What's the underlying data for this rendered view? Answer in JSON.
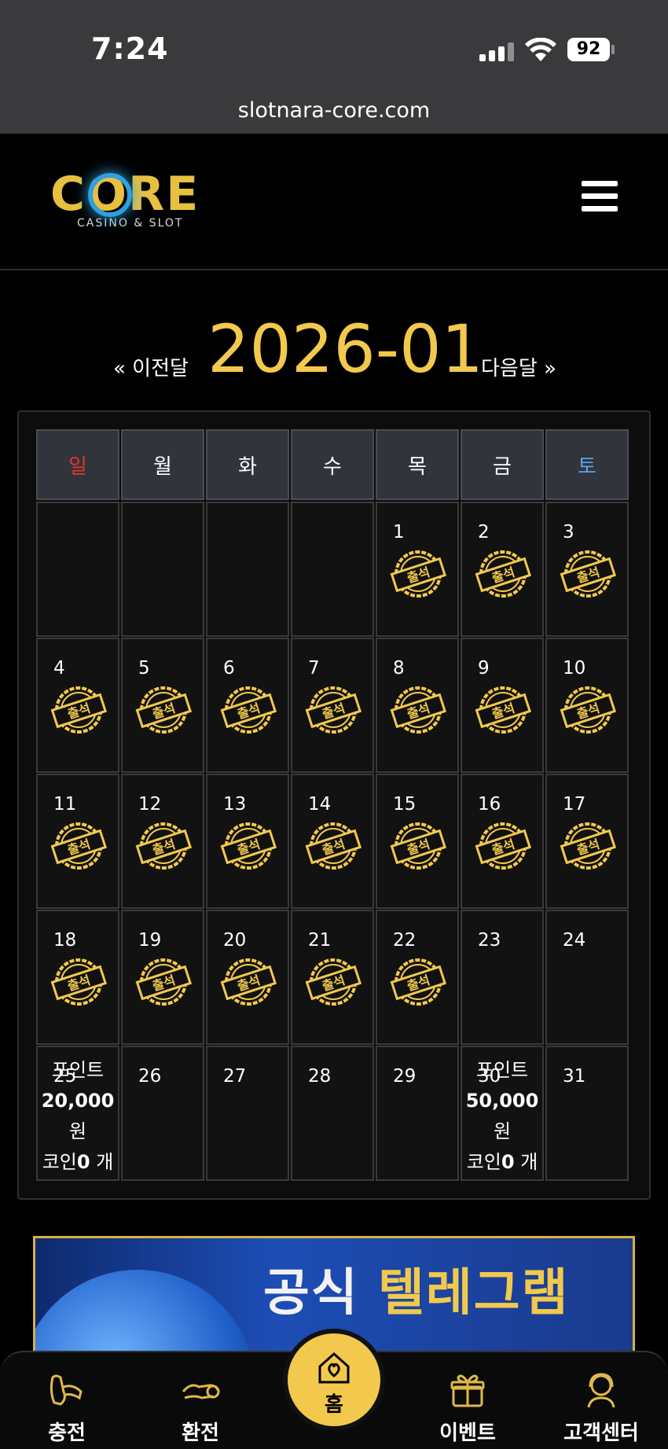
{
  "status_bar": {
    "time": "7:24",
    "battery": "92"
  },
  "browser": {
    "url": "slotnara-core.com"
  },
  "header": {
    "logo_text": "CORE",
    "logo_subtitle": "CASINO & SLOT"
  },
  "calendar": {
    "prev_label": "« 이전달",
    "next_label": "다음달 »",
    "month": "2026-01",
    "weekdays": [
      "일",
      "월",
      "화",
      "수",
      "목",
      "금",
      "토"
    ],
    "stamp_label": "출석",
    "weeks": [
      [
        null,
        null,
        null,
        null,
        {
          "day": "1",
          "stamp": true
        },
        {
          "day": "2",
          "stamp": true
        },
        {
          "day": "3",
          "stamp": true
        }
      ],
      [
        {
          "day": "4",
          "stamp": true
        },
        {
          "day": "5",
          "stamp": true
        },
        {
          "day": "6",
          "stamp": true
        },
        {
          "day": "7",
          "stamp": true
        },
        {
          "day": "8",
          "stamp": true
        },
        {
          "day": "9",
          "stamp": true
        },
        {
          "day": "10",
          "stamp": true
        }
      ],
      [
        {
          "day": "11",
          "stamp": true
        },
        {
          "day": "12",
          "stamp": true
        },
        {
          "day": "13",
          "stamp": true
        },
        {
          "day": "14",
          "stamp": true
        },
        {
          "day": "15",
          "stamp": true
        },
        {
          "day": "16",
          "stamp": true
        },
        {
          "day": "17",
          "stamp": true
        }
      ],
      [
        {
          "day": "18",
          "stamp": true
        },
        {
          "day": "19",
          "stamp": true
        },
        {
          "day": "20",
          "stamp": true
        },
        {
          "day": "21",
          "stamp": true
        },
        {
          "day": "22",
          "stamp": true
        },
        {
          "day": "23",
          "stamp": false
        },
        {
          "day": "24",
          "stamp": false
        }
      ],
      [
        {
          "day": "25",
          "stamp": false,
          "reward": {
            "point_label": "포인트",
            "amount": "20,000",
            "unit": "원",
            "coin_label": "코인",
            "coin_count": "0",
            "coin_unit": " 개"
          }
        },
        {
          "day": "26",
          "stamp": false
        },
        {
          "day": "27",
          "stamp": false
        },
        {
          "day": "28",
          "stamp": false
        },
        {
          "day": "29",
          "stamp": false
        },
        {
          "day": "30",
          "stamp": false,
          "reward": {
            "point_label": "포인트",
            "amount": "50,000",
            "unit": "원",
            "coin_label": "코인",
            "coin_count": "0",
            "coin_unit": " 개"
          }
        },
        {
          "day": "31",
          "stamp": false
        }
      ]
    ]
  },
  "banner": {
    "text_white": "공식",
    "text_gold": "텔레그램"
  },
  "bottom_nav": {
    "items": [
      {
        "label": "충전",
        "icon": "charge-icon"
      },
      {
        "label": "환전",
        "icon": "exchange-icon"
      },
      {
        "label": "홈",
        "icon": "home-icon"
      },
      {
        "label": "이벤트",
        "icon": "gift-icon"
      },
      {
        "label": "고객센터",
        "icon": "support-icon"
      }
    ]
  },
  "colors": {
    "gold": "#f2c94c",
    "sunday": "#e0352b",
    "saturday": "#5aa3e6"
  }
}
